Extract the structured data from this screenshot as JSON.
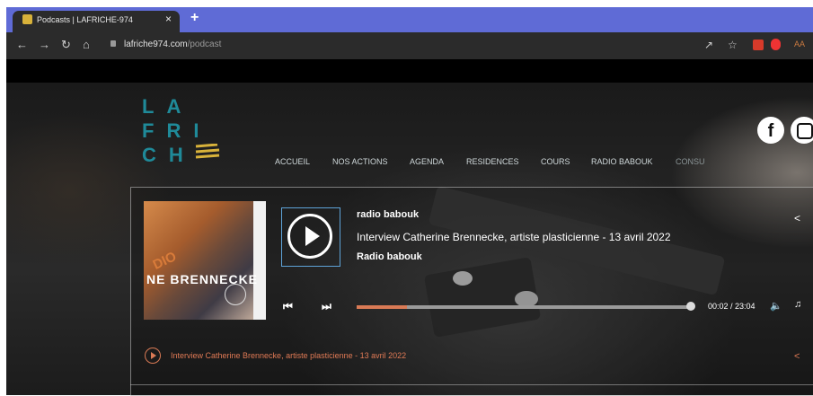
{
  "browser": {
    "tab_title": "Podcasts | LAFRICHE-974",
    "tab_close": "×",
    "new_tab": "+",
    "url_domain": "lafriche974.com",
    "url_path": "/podcast",
    "profile_initials": "AA"
  },
  "site": {
    "logo_line1": "LA",
    "logo_line2": "FRI",
    "logo_line3": "CH",
    "nav": [
      "ACCUEIL",
      "NOS ACTIONS",
      "AGENDA",
      "RESIDENCES",
      "COURS",
      "RADIO BABOUK",
      "CONSU"
    ],
    "social_fb": "f"
  },
  "player": {
    "station": "radio babouk",
    "title": "Interview Catherine Brennecke, artiste plasticienne - 13 avril 2022",
    "artist": "Radio babouk",
    "cover_text": "NE BRENNECKE",
    "cover_radio": "DIO",
    "time": "00:02 / 23:04",
    "progress": 0.15,
    "track_label": "Interview Catherine Brennecke, artiste plasticienne - 13 avril 2022"
  },
  "colors": {
    "accent": "#d97a55",
    "logo": "#1f8a99",
    "tab_strip": "#5f6bd6"
  },
  "icons": {
    "back": "arrow-left-icon",
    "forward": "arrow-right-icon",
    "reload": "reload-icon",
    "home": "home-icon",
    "share": "share-icon",
    "star": "star-icon",
    "play": "play-icon",
    "prev": "skip-back-icon",
    "next": "skip-forward-icon",
    "volume": "volume-icon",
    "list": "playlist-icon"
  }
}
